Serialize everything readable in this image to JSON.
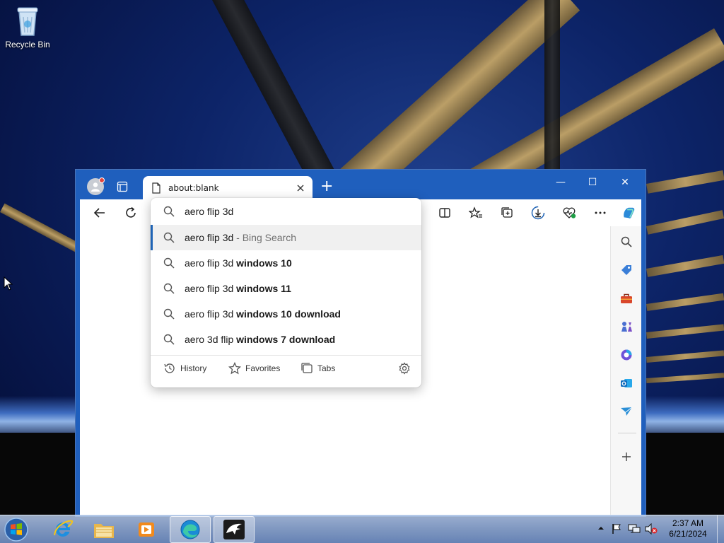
{
  "desktop": {
    "recycle_bin_label": "Recycle Bin"
  },
  "browser": {
    "tab_title": "about:blank",
    "window_controls": {
      "minimize": "—",
      "maximize": "☐",
      "close": "✕"
    },
    "new_tab_glyph": "+",
    "address": {
      "value": "aero flip 3d"
    },
    "suggestions": [
      {
        "prefix": "aero flip 3d",
        "bold": "",
        "hint": " - Bing Search"
      },
      {
        "prefix": "aero flip 3d ",
        "bold": "windows 10",
        "hint": ""
      },
      {
        "prefix": "aero flip 3d ",
        "bold": "windows 11",
        "hint": ""
      },
      {
        "prefix": "aero flip 3d ",
        "bold": "windows 10 download",
        "hint": ""
      },
      {
        "prefix": "aero 3d flip ",
        "bold": "windows 7 download",
        "hint": ""
      }
    ],
    "footer": {
      "history": "History",
      "favorites": "Favorites",
      "tabs": "Tabs"
    },
    "accent_color": "#1f5fbd"
  },
  "taskbar": {
    "clock_time": "2:37 AM",
    "clock_date": "6/21/2024"
  }
}
